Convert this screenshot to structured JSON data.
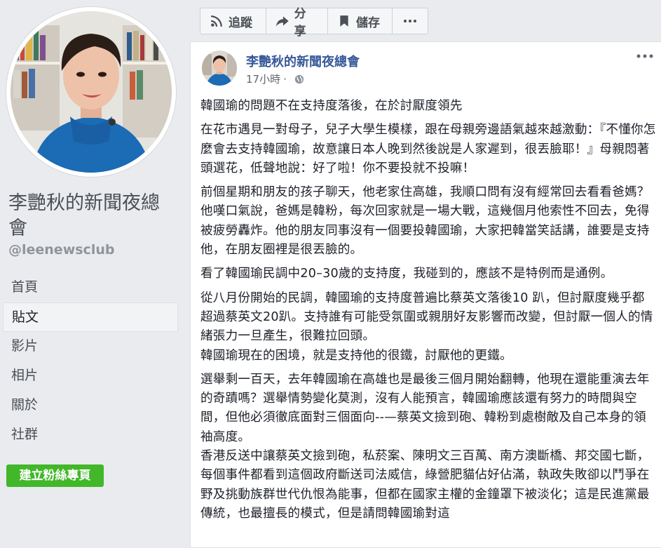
{
  "sidebar": {
    "page_name": "李艷秋的新聞夜總會",
    "username": "@leenewsclub",
    "nav": [
      {
        "label": "首頁"
      },
      {
        "label": "貼文"
      },
      {
        "label": "影片"
      },
      {
        "label": "相片"
      },
      {
        "label": "關於"
      },
      {
        "label": "社群"
      }
    ],
    "active_nav": "貼文",
    "create_button": "建立粉絲專頁"
  },
  "toolbar": {
    "follow_label": "追蹤",
    "share_label": "分享",
    "save_label": "儲存",
    "more_icon": "ellipsis-icon"
  },
  "post": {
    "author": "李艷秋的新聞夜總會",
    "time": "17小時",
    "privacy_icon": "globe-icon",
    "paragraphs": [
      "韓國瑜的問題不在支持度落後，在於討厭度領先",
      "在花市遇見一對母子，兒子大學生模樣，跟在母親旁邊語氣越來越激動：『不懂你怎麼會去支持韓國瑜，故意讓日本人晚到然後說是人家遲到，很丟臉耶！』母親悶著頭選花，低聲地說：好了啦！你不要投就不投嘛！",
      "前個星期和朋友的孩子聊天，他老家住高雄，我順口問有沒有經常回去看看爸媽？他嘆口氣說，爸媽是韓粉，每次回家就是一場大戰，這幾個月他索性不回去，免得被疲勞轟炸。他的朋友同事沒有一個要投韓國瑜，大家把韓當笑話講，誰要是支持他，在朋友圈裡是很丟臉的。",
      "看了韓國瑜民調中20–30歲的支持度，我碰到的，應該不是特例而是通例。",
      "從八月份開始的民調，韓國瑜的支持度普遍比蔡英文落後10 趴，但討厭度幾乎都超過蔡英文20趴。支持誰有可能受氛圍或親朋好友影響而改變，但討厭一個人的情緒張力一旦產生，很難拉回頭。",
      "韓國瑜現在的困境，就是支持他的很鐵，討厭他的更鐵。",
      "選舉剩一百天，去年韓國瑜在高雄也是最後三個月開始翻轉，他現在還能重演去年的奇蹟嗎？選舉情勢變化莫測，沒有人能預言，韓國瑜應該還有努力的時間與空間，但他必須徹底面對三個面向--—蔡英文撿到砲、韓粉到處樹敵及自己本身的領袖高度。",
      "香港反送中讓蔡英文撿到砲，私菸案、陳明文三百萬、南方澳斷橋、邦交國七斷，每個事件都看到這個政府斷送司法威信，綠營肥貓佔好佔滿，執政失敗卻以鬥爭在野及挑動族群世代仇恨為能事，但都在國家主權的金鐘罩下被淡化；這是民進黨最傳統，也最擅長的模式，但是請問韓國瑜對這"
    ]
  },
  "colors": {
    "link_blue": "#365899",
    "green_button": "#42b72a",
    "page_bg": "#e9ebee"
  }
}
